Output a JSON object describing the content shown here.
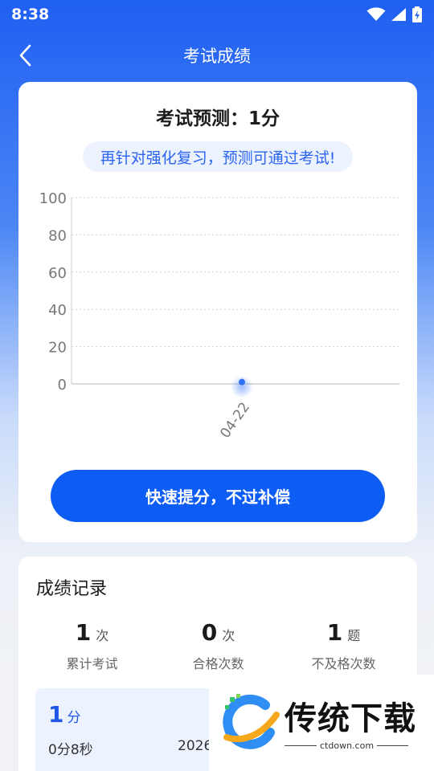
{
  "status_bar": {
    "time": "8:38"
  },
  "nav": {
    "title": "考试成绩"
  },
  "forecast": {
    "title": "考试预测：1分",
    "tip": "再针对强化复习，预测可通过考试!",
    "cta_label": "快速提分，不过补偿"
  },
  "chart_data": {
    "type": "line",
    "x": [
      "04-22"
    ],
    "values": [
      1
    ],
    "ylim": [
      0,
      100
    ],
    "yticks": [
      0,
      20,
      40,
      60,
      80,
      100
    ],
    "grid": true,
    "title": "",
    "xlabel": "",
    "ylabel": "",
    "color": "#2e6ff5"
  },
  "records": {
    "title": "成绩记录",
    "stats": [
      {
        "value": "1",
        "unit": "次",
        "label": "累计考试"
      },
      {
        "value": "0",
        "unit": "次",
        "label": "合格次数"
      },
      {
        "value": "1",
        "unit": "题",
        "label": "不及格次数"
      }
    ],
    "items": [
      {
        "score": "1",
        "score_unit": "分",
        "duration": "0分8秒",
        "date": "2026-04"
      }
    ]
  },
  "watermark": {
    "text": "传统下载",
    "url": "ctdown.com"
  },
  "colors": {
    "primary": "#0d5df5",
    "header": "#1f5ff2",
    "tip_bg": "#ecf2fe"
  }
}
